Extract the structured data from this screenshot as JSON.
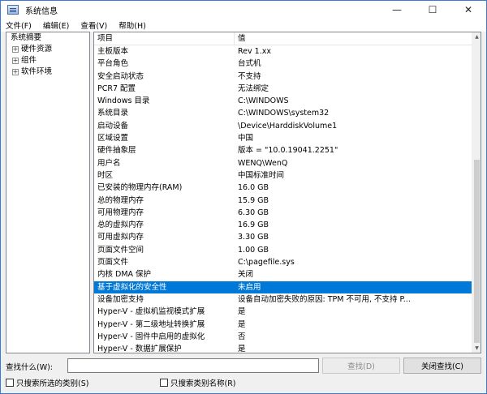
{
  "window": {
    "title": "系统信息",
    "controls": {
      "minimize": "—",
      "maximize": "☐",
      "close": "✕"
    }
  },
  "menu": {
    "items": [
      "文件(F)",
      "编辑(E)",
      "查看(V)",
      "帮助(H)"
    ]
  },
  "tree": {
    "root": "系统摘要",
    "children": [
      "硬件资源",
      "组件",
      "软件环境"
    ],
    "expander": "+"
  },
  "list": {
    "headers": {
      "item": "项目",
      "value": "值"
    },
    "rows": [
      {
        "item": "主板版本",
        "value": "Rev 1.xx"
      },
      {
        "item": "平台角色",
        "value": "台式机"
      },
      {
        "item": "安全启动状态",
        "value": "不支持"
      },
      {
        "item": "PCR7 配置",
        "value": "无法绑定"
      },
      {
        "item": "Windows 目录",
        "value": "C:\\WINDOWS"
      },
      {
        "item": "系统目录",
        "value": "C:\\WINDOWS\\system32"
      },
      {
        "item": "启动设备",
        "value": "\\Device\\HarddiskVolume1"
      },
      {
        "item": "区域设置",
        "value": "中国"
      },
      {
        "item": "硬件抽象层",
        "value": "版本 = \"10.0.19041.2251\""
      },
      {
        "item": "用户名",
        "value": "WENQ\\WenQ"
      },
      {
        "item": "时区",
        "value": "中国标准时间"
      },
      {
        "item": "已安装的物理内存(RAM)",
        "value": "16.0 GB"
      },
      {
        "item": "总的物理内存",
        "value": "15.9 GB"
      },
      {
        "item": "可用物理内存",
        "value": "6.30 GB"
      },
      {
        "item": "总的虚拟内存",
        "value": "16.9 GB"
      },
      {
        "item": "可用虚拟内存",
        "value": "3.30 GB"
      },
      {
        "item": "页面文件空间",
        "value": "1.00 GB"
      },
      {
        "item": "页面文件",
        "value": "C:\\pagefile.sys"
      },
      {
        "item": "内核 DMA 保护",
        "value": "关闭"
      },
      {
        "item": "基于虚拟化的安全性",
        "value": "未启用",
        "selected": true
      },
      {
        "item": "设备加密支持",
        "value": "设备自动加密失败的原因: TPM 不可用, 不支持 P..."
      },
      {
        "item": "Hyper-V - 虚拟机监视模式扩展",
        "value": "是"
      },
      {
        "item": "Hyper-V - 第二级地址转换扩展",
        "value": "是"
      },
      {
        "item": "Hyper-V - 固件中启用的虚拟化",
        "value": "否"
      },
      {
        "item": "Hyper-V - 数据扩展保护",
        "value": "是"
      }
    ]
  },
  "scrollbar": {
    "up": "▲",
    "down": "▼"
  },
  "find": {
    "label": "查找什么(W):",
    "input_value": "",
    "find_button": "查找(D)",
    "close_button": "关闭查找(C)",
    "checkbox_selected_category": "只搜索所选的类别(S)",
    "checkbox_category_names": "只搜索类别名称(R)"
  },
  "colors": {
    "selection": "#0078d7",
    "window_border": "#3a7bd5"
  }
}
